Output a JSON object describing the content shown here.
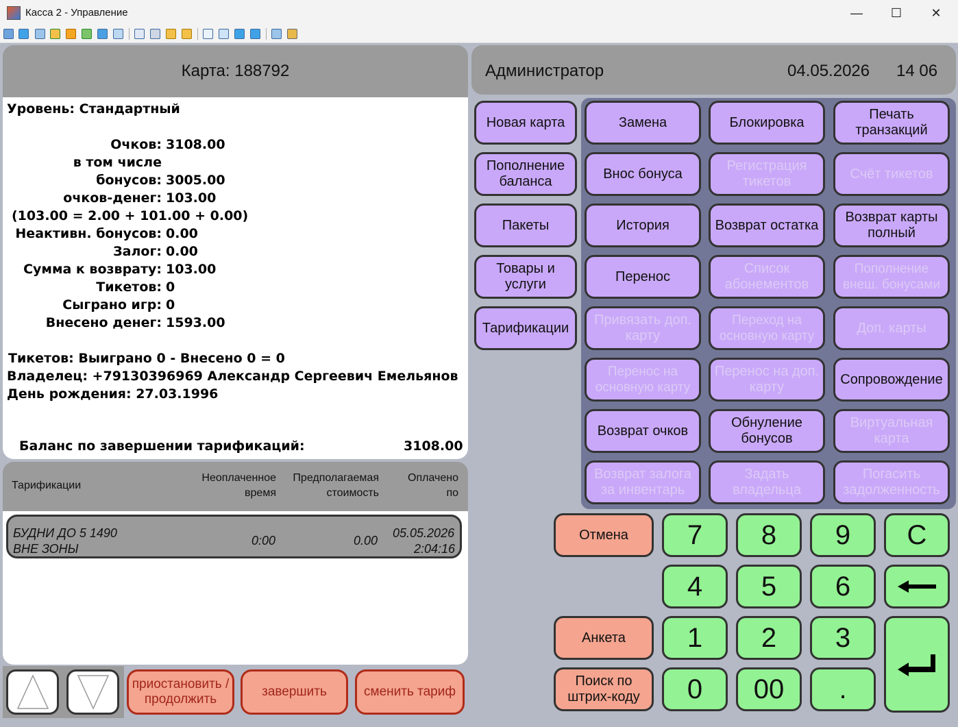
{
  "window": {
    "title": "Касса 2 - Управление",
    "minimize": "—",
    "maximize": "☐",
    "close": "✕"
  },
  "card": {
    "title": "Карта: 188792",
    "level": "Уровень: Стандартный",
    "stats": [
      {
        "label": "Очков:",
        "value": "3108.00"
      },
      {
        "label": "в том числе",
        "value": ""
      },
      {
        "label": "бонусов:",
        "value": "3005.00"
      },
      {
        "label": "очков-денег:",
        "value": "103.00"
      },
      {
        "label": "(103.00 = 2.00 + 101.00 + 0.00)",
        "value": ""
      },
      {
        "label": "Неактивн. бонусов:",
        "value": "0.00"
      },
      {
        "label": "Залог:",
        "value": "0.00"
      },
      {
        "label": "Сумма к возврату:",
        "value": "103.00"
      },
      {
        "label": "Тикетов:",
        "value": "0"
      },
      {
        "label": "Сыграно игр:",
        "value": "0"
      },
      {
        "label": "Внесено денег:",
        "value": "1593.00"
      }
    ],
    "tickets": "Тикетов: Выиграно 0 - Внесено 0 = 0",
    "owner": "Владелец: +79130396969 Александр Сергеевич Емельянов",
    "birthday": "День рождения: 27.03.1996",
    "balance_label": "Баланс по завершении тарификаций:",
    "balance_value": "3108.00"
  },
  "header": {
    "user": "Администратор",
    "date": "04.05.2026",
    "time": "14 06"
  },
  "actions": {
    "left": [
      "Новая карта",
      "Пополнение баланса",
      "Пакеты",
      "Товары и услуги",
      "Тарификации"
    ],
    "grid": [
      {
        "label": "Замена",
        "enabled": true
      },
      {
        "label": "Блокировка",
        "enabled": true
      },
      {
        "label": "Печать транзакций",
        "enabled": true
      },
      {
        "label": "Внос бонуса",
        "enabled": true
      },
      {
        "label": "Регистрация тикетов",
        "enabled": false
      },
      {
        "label": "Счёт тикетов",
        "enabled": false
      },
      {
        "label": "История",
        "enabled": true
      },
      {
        "label": "Возврат остатка",
        "enabled": true
      },
      {
        "label": "Возврат карты полный",
        "enabled": true
      },
      {
        "label": "Перенос",
        "enabled": true
      },
      {
        "label": "Список абонементов",
        "enabled": false
      },
      {
        "label": "Пополнение внеш. бонусами",
        "enabled": false
      },
      {
        "label": "Привязать доп. карту",
        "enabled": false
      },
      {
        "label": "Переход на основную карту",
        "enabled": false
      },
      {
        "label": "Доп. карты",
        "enabled": false
      },
      {
        "label": "Перенос на основную карту",
        "enabled": false
      },
      {
        "label": "Перенос на доп. карту",
        "enabled": false
      },
      {
        "label": "Сопровождение",
        "enabled": true
      },
      {
        "label": "Возврат очков",
        "enabled": true
      },
      {
        "label": "Обнуление бонусов",
        "enabled": true
      },
      {
        "label": "Виртуальная карта",
        "enabled": false
      },
      {
        "label": "Возврат залога за инвентарь",
        "enabled": false
      },
      {
        "label": "Задать владельца",
        "enabled": false
      },
      {
        "label": "Погасить задолженность",
        "enabled": false
      }
    ]
  },
  "tariffs": {
    "columns": [
      "Тарификации",
      "Неоплаченное время",
      "Предполагаемая стоимость",
      "Оплачено по"
    ],
    "rows": [
      {
        "name1": "БУДНИ ДО 5 1490",
        "name2": "ВНЕ ЗОНЫ",
        "unpaid": "0:00",
        "cost": "0.00",
        "paid_date": "05.05.2026",
        "paid_time": "2:04:16"
      }
    ]
  },
  "bottom": {
    "up": "▲",
    "down": "▼",
    "pause": "приостановить / продолжить",
    "finish": "завершить",
    "change": "сменить тариф"
  },
  "keypad": {
    "cancel": "Отмена",
    "survey": "Анкета",
    "barcode": "Поиск по штрих-коду",
    "keys": [
      "7",
      "8",
      "9",
      "C",
      "4",
      "5",
      "6",
      "1",
      "2",
      "3",
      "0",
      "00",
      "."
    ]
  },
  "colors": {
    "panel": "#9a9b9a",
    "purple": "#c9a8f9",
    "green": "#93f293",
    "salmon": "#f4a48f",
    "blue_area": "#737797",
    "bg": "#b4b9c5"
  }
}
